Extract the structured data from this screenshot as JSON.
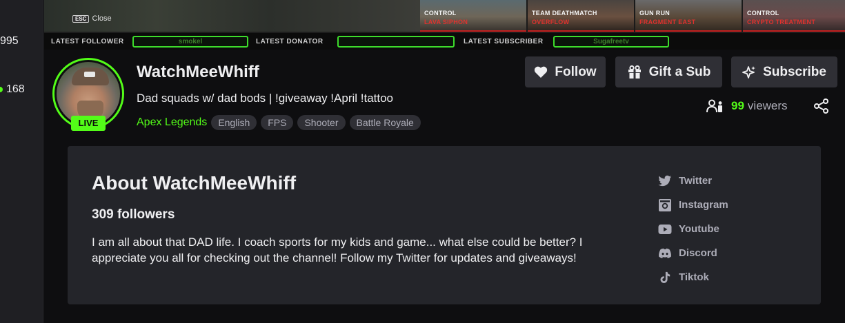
{
  "sidebar": {
    "counts": [
      "995",
      "168"
    ]
  },
  "player": {
    "esc_key": "ESC",
    "esc_label": "Close",
    "maps": [
      {
        "mode": "CONTROL",
        "name": "LAVA SIPHON"
      },
      {
        "mode": "TEAM DEATHMATCH",
        "name": "OVERFLOW"
      },
      {
        "mode": "GUN RUN",
        "name": "FRAGMENT EAST"
      },
      {
        "mode": "CONTROL",
        "name": "CRYPTO TREATMENT"
      }
    ],
    "ticker": {
      "follower_label": "LATEST FOLLOWER",
      "follower_value": "smokel",
      "donator_label": "LATEST DONATOR",
      "donator_value": "",
      "subscriber_label": "LATEST SUBSCRIBER",
      "subscriber_value": "Sugafreetv"
    }
  },
  "channel": {
    "name": "WatchMeeWhiff",
    "live_label": "LIVE",
    "stream_title": "Dad squads w/ dad bods | !giveaway !April !tattoo",
    "category": "Apex Legends",
    "tags": [
      "English",
      "FPS",
      "Shooter",
      "Battle Royale"
    ],
    "buttons": {
      "follow": "Follow",
      "gift": "Gift a Sub",
      "subscribe": "Subscribe"
    },
    "viewer_count": "99",
    "viewer_label": "viewers"
  },
  "about": {
    "title": "About WatchMeeWhiff",
    "followers": "309 followers",
    "bio": "I am all about that DAD life. I coach sports for my kids and game... what else could be better? I appreciate you all for checking out the channel! Follow my Twitter for updates and giveaways!",
    "socials": [
      {
        "label": "Twitter",
        "icon": "twitter-icon"
      },
      {
        "label": "Instagram",
        "icon": "instagram-icon"
      },
      {
        "label": "Youtube",
        "icon": "youtube-icon"
      },
      {
        "label": "Discord",
        "icon": "discord-icon"
      },
      {
        "label": "Tiktok",
        "icon": "tiktok-icon"
      }
    ]
  },
  "colors": {
    "accent": "#53fc18",
    "panel": "#24252a",
    "button": "#2f2f35",
    "background": "#0e0e10"
  }
}
